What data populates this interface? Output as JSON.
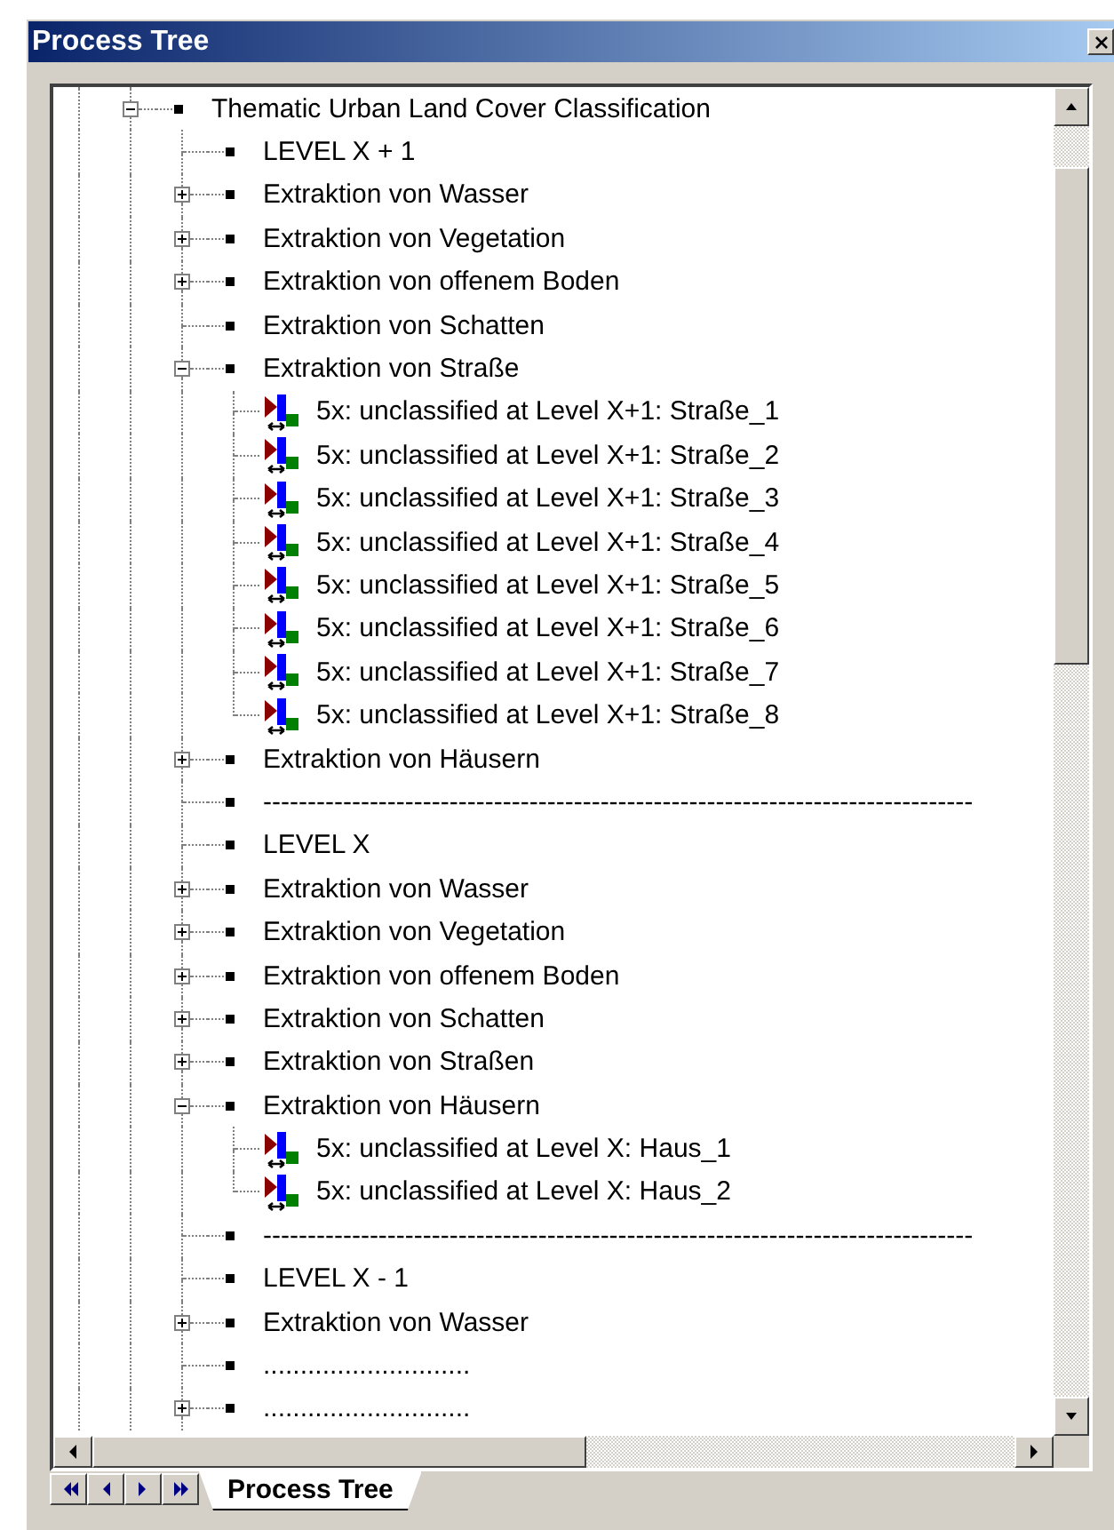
{
  "window": {
    "title": "Process Tree"
  },
  "tree": [
    {
      "label": "Thematic Urban Land Cover Classification",
      "kind": "bullet",
      "expanded": true,
      "children": [
        {
          "label": "LEVEL X + 1",
          "kind": "bullet"
        },
        {
          "label": "Extraktion von Wasser",
          "kind": "bullet",
          "expanded": false
        },
        {
          "label": "Extraktion von Vegetation",
          "kind": "bullet",
          "expanded": false
        },
        {
          "label": "Extraktion von offenem Boden",
          "kind": "bullet",
          "expanded": false
        },
        {
          "label": "Extraktion von Schatten",
          "kind": "bullet"
        },
        {
          "label": "Extraktion von Straße",
          "kind": "bullet",
          "expanded": true,
          "children": [
            {
              "label": "5x: unclassified at Level X+1: Straße_1",
              "kind": "process"
            },
            {
              "label": "5x: unclassified at Level X+1: Straße_2",
              "kind": "process"
            },
            {
              "label": "5x: unclassified at Level X+1: Straße_3",
              "kind": "process"
            },
            {
              "label": "5x: unclassified at Level X+1: Straße_4",
              "kind": "process"
            },
            {
              "label": "5x: unclassified at Level X+1: Straße_5",
              "kind": "process"
            },
            {
              "label": "5x: unclassified at Level X+1: Straße_6",
              "kind": "process"
            },
            {
              "label": "5x: unclassified at Level X+1: Straße_7",
              "kind": "process"
            },
            {
              "label": "5x: unclassified at Level X+1: Straße_8",
              "kind": "process"
            }
          ]
        },
        {
          "label": "Extraktion von Häusern",
          "kind": "bullet",
          "expanded": false
        },
        {
          "label": "--------------------------------------------------------------------------------",
          "kind": "bullet"
        },
        {
          "label": "LEVEL X",
          "kind": "bullet"
        },
        {
          "label": "Extraktion von Wasser",
          "kind": "bullet",
          "expanded": false
        },
        {
          "label": "Extraktion von Vegetation",
          "kind": "bullet",
          "expanded": false
        },
        {
          "label": "Extraktion von offenem Boden",
          "kind": "bullet",
          "expanded": false
        },
        {
          "label": "Extraktion von Schatten",
          "kind": "bullet",
          "expanded": false
        },
        {
          "label": "Extraktion von Straßen",
          "kind": "bullet",
          "expanded": false
        },
        {
          "label": "Extraktion von Häusern",
          "kind": "bullet",
          "expanded": true,
          "children": [
            {
              "label": "5x: unclassified at Level X: Haus_1",
              "kind": "process"
            },
            {
              "label": "5x: unclassified at Level X: Haus_2",
              "kind": "process"
            }
          ]
        },
        {
          "label": "--------------------------------------------------------------------------------",
          "kind": "bullet"
        },
        {
          "label": "LEVEL X - 1",
          "kind": "bullet"
        },
        {
          "label": "Extraktion von Wasser",
          "kind": "bullet",
          "expanded": false
        },
        {
          "label": "............................",
          "kind": "bullet"
        },
        {
          "label": "............................",
          "kind": "bullet",
          "expanded": false
        }
      ]
    }
  ],
  "tab_bar": {
    "tabs": [
      {
        "label": "Process Tree",
        "selected": true
      }
    ]
  }
}
